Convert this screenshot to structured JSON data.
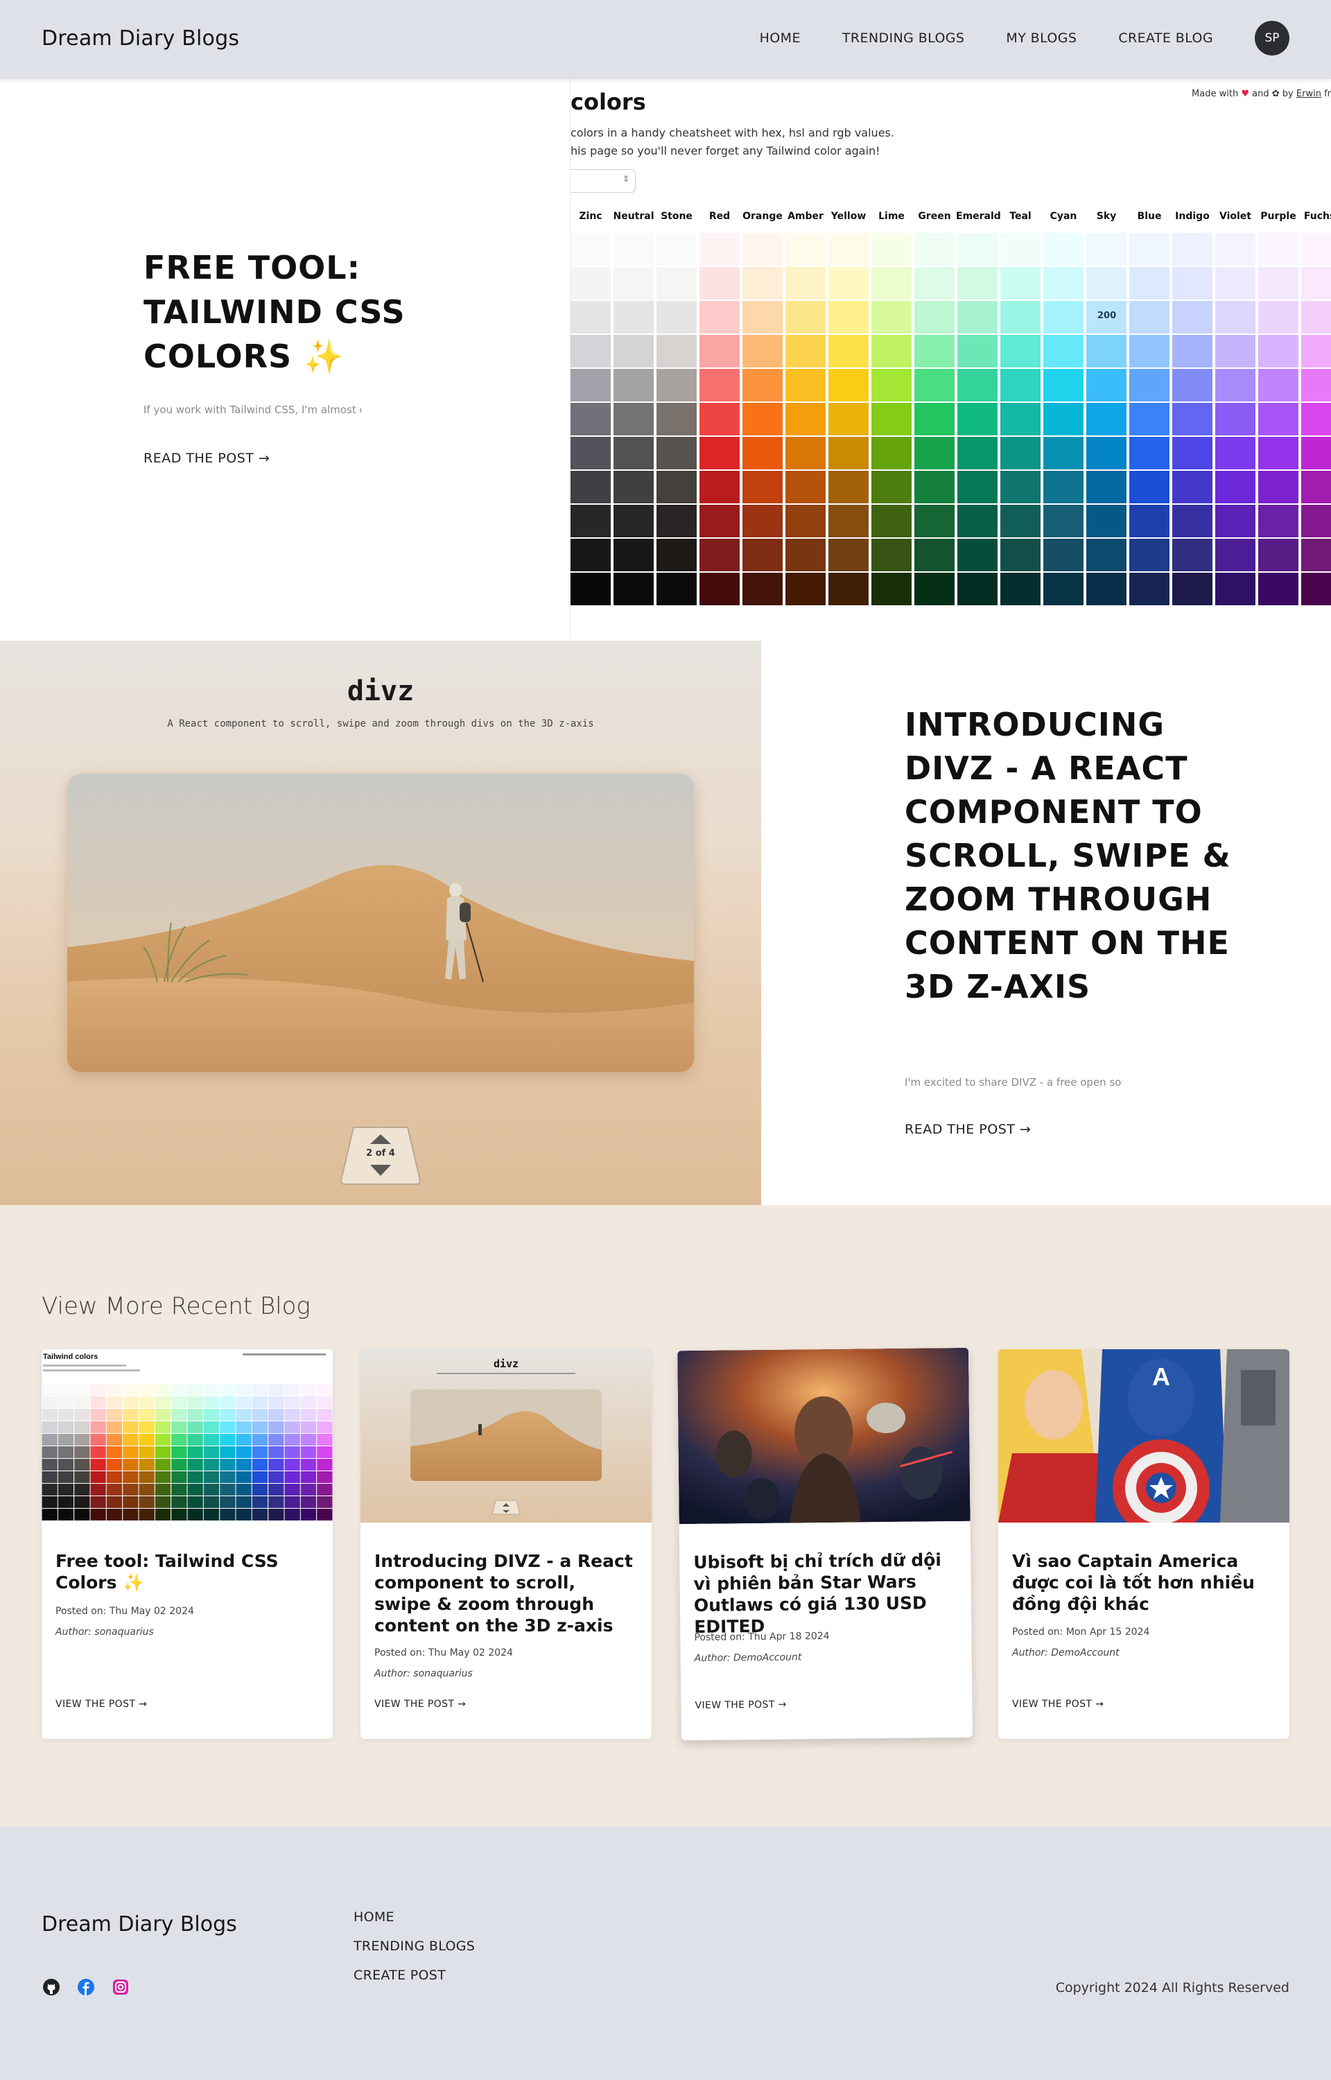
{
  "header": {
    "brand": "Dream Diary Blogs",
    "nav": [
      "HOME",
      "TRENDING BLOGS",
      "MY BLOGS",
      "CREATE BLOG"
    ],
    "avatar_initials": "SP"
  },
  "featured": [
    {
      "title": "FREE TOOL: TAILWIND CSS COLORS ✨",
      "excerpt": "If you work with Tailwind CSS, I'm almost ce",
      "read_more": "READ THE POST →"
    },
    {
      "title": "INTRODUCING DIVZ - A REACT COMPONENT TO SCROLL, SWIPE & ZOOM THROUGH CONTENT ON THE 3D Z-AXIS",
      "excerpt": "I'm excited to share DIVZ - a free open sou",
      "read_more": "READ THE POST →"
    }
  ],
  "tailwind_preview": {
    "title": "colors",
    "desc_line1": "colors in a handy cheatsheet with hex, hsl and rgb values.",
    "desc_line2": "his page so you'll never forget any Tailwind color again!",
    "made_with": "Made with",
    "and": "and",
    "by": "by",
    "author_link": "Erwin",
    "trailing": "fr",
    "highlight_label": "200",
    "columns": [
      "Zinc",
      "Neutral",
      "Stone",
      "Red",
      "Orange",
      "Amber",
      "Yellow",
      "Lime",
      "Green",
      "Emerald",
      "Teal",
      "Cyan",
      "Sky",
      "Blue",
      "Indigo",
      "Violet",
      "Purple",
      "Fuchsi"
    ],
    "palettes": [
      [
        "#fafafa",
        "#f4f4f5",
        "#e4e4e7",
        "#d4d4d8",
        "#a1a1aa",
        "#71717a",
        "#52525b",
        "#3f3f46",
        "#27272a",
        "#18181b",
        "#09090b"
      ],
      [
        "#fafafa",
        "#f5f5f5",
        "#e5e5e5",
        "#d4d4d4",
        "#a3a3a3",
        "#737373",
        "#525252",
        "#404040",
        "#262626",
        "#171717",
        "#0a0a0a"
      ],
      [
        "#fafaf9",
        "#f5f5f4",
        "#e7e5e4",
        "#d6d3d1",
        "#a8a29e",
        "#78716c",
        "#57534e",
        "#44403c",
        "#292524",
        "#1c1917",
        "#0c0a09"
      ],
      [
        "#fef2f2",
        "#fee2e2",
        "#fecaca",
        "#fca5a5",
        "#f87171",
        "#ef4444",
        "#dc2626",
        "#b91c1c",
        "#991b1b",
        "#7f1d1d",
        "#450a0a"
      ],
      [
        "#fff7ed",
        "#ffedd5",
        "#fed7aa",
        "#fdba74",
        "#fb923c",
        "#f97316",
        "#ea580c",
        "#c2410c",
        "#9a3412",
        "#7c2d12",
        "#431407"
      ],
      [
        "#fffbeb",
        "#fef3c7",
        "#fde68a",
        "#fcd34d",
        "#fbbf24",
        "#f59e0b",
        "#d97706",
        "#b45309",
        "#92400e",
        "#78350f",
        "#451a03"
      ],
      [
        "#fefce8",
        "#fef9c3",
        "#fef08a",
        "#fde047",
        "#facc15",
        "#eab308",
        "#ca8a04",
        "#a16207",
        "#854d0e",
        "#713f12",
        "#422006"
      ],
      [
        "#f7fee7",
        "#ecfccb",
        "#d9f99d",
        "#bef264",
        "#a3e635",
        "#84cc16",
        "#65a30d",
        "#4d7c0f",
        "#3f6212",
        "#365314",
        "#1a2e05"
      ],
      [
        "#f0fdf4",
        "#dcfce7",
        "#bbf7d0",
        "#86efac",
        "#4ade80",
        "#22c55e",
        "#16a34a",
        "#15803d",
        "#166534",
        "#14532d",
        "#052e16"
      ],
      [
        "#ecfdf5",
        "#d1fae5",
        "#a7f3d0",
        "#6ee7b7",
        "#34d399",
        "#10b981",
        "#059669",
        "#047857",
        "#065f46",
        "#064e3b",
        "#022c22"
      ],
      [
        "#f0fdfa",
        "#ccfbf1",
        "#99f6e4",
        "#5eead4",
        "#2dd4bf",
        "#14b8a6",
        "#0d9488",
        "#0f766e",
        "#115e59",
        "#134e4a",
        "#042f2e"
      ],
      [
        "#ecfeff",
        "#cffafe",
        "#a5f3fc",
        "#67e8f9",
        "#22d3ee",
        "#06b6d4",
        "#0891b2",
        "#0e7490",
        "#155e75",
        "#164e63",
        "#083344"
      ],
      [
        "#f0f9ff",
        "#e0f2fe",
        "#bae6fd",
        "#7dd3fc",
        "#38bdf8",
        "#0ea5e9",
        "#0284c7",
        "#0369a1",
        "#075985",
        "#0c4a6e",
        "#082f49"
      ],
      [
        "#eff6ff",
        "#dbeafe",
        "#bfdbfe",
        "#93c5fd",
        "#60a5fa",
        "#3b82f6",
        "#2563eb",
        "#1d4ed8",
        "#1e40af",
        "#1e3a8a",
        "#172554"
      ],
      [
        "#eef2ff",
        "#e0e7ff",
        "#c7d2fe",
        "#a5b4fc",
        "#818cf8",
        "#6366f1",
        "#4f46e5",
        "#4338ca",
        "#3730a3",
        "#312e81",
        "#1e1b4b"
      ],
      [
        "#f5f3ff",
        "#ede9fe",
        "#ddd6fe",
        "#c4b5fd",
        "#a78bfa",
        "#8b5cf6",
        "#7c3aed",
        "#6d28d9",
        "#5b21b6",
        "#4c1d95",
        "#2e1065"
      ],
      [
        "#faf5ff",
        "#f3e8ff",
        "#e9d5ff",
        "#d8b4fe",
        "#c084fc",
        "#a855f7",
        "#9333ea",
        "#7e22ce",
        "#6b21a8",
        "#581c87",
        "#3b0764"
      ],
      [
        "#fdf4ff",
        "#fae8ff",
        "#f5d0fe",
        "#f0abfc",
        "#e879f9",
        "#d946ef",
        "#c026d3",
        "#a21caf",
        "#86198f",
        "#701a75",
        "#4a044e"
      ]
    ]
  },
  "divz_preview": {
    "title": "divz",
    "subtitle": "A React component to scroll, swipe and zoom through divs on the 3D z-axis",
    "counter": "2 of 4"
  },
  "recent": {
    "heading": "View More Recent Blog",
    "cards": [
      {
        "title": "Free tool: Tailwind CSS Colors ✨",
        "posted": "Posted on: Thu May 02 2024",
        "author": "Author: sonaquarius",
        "link": "VIEW THE POST →"
      },
      {
        "title": "Introducing DIVZ - a React component to scroll, swipe & zoom through content on the 3D z-axis",
        "posted": "Posted on: Thu May 02 2024",
        "author": "Author: sonaquarius",
        "link": "VIEW THE POST →"
      },
      {
        "title": "Ubisoft bị chỉ trích dữ dội vì phiên bản Star Wars Outlaws có giá 130 USD EDITED",
        "posted": "Posted on: Thu Apr 18 2024",
        "author": "Author: DemoAccount",
        "link": "VIEW THE POST →"
      },
      {
        "title": "Vì sao Captain America được coi là tốt hơn nhiều đồng đội khác",
        "posted": "Posted on: Mon Apr 15 2024",
        "author": "Author: DemoAccount",
        "link": "VIEW THE POST →"
      }
    ]
  },
  "footer": {
    "brand": "Dream Diary Blogs",
    "links": [
      "HOME",
      "TRENDING BLOGS",
      "CREATE POST"
    ],
    "copyright": "Copyright 2024 All Rights Reserved"
  },
  "colors": {
    "header_bg": "#dfe1e8",
    "recent_bg": "#f1e8df",
    "avatar_bg": "#2b2d31",
    "facebook": "#1877f2",
    "instagram": "#d6249f"
  }
}
